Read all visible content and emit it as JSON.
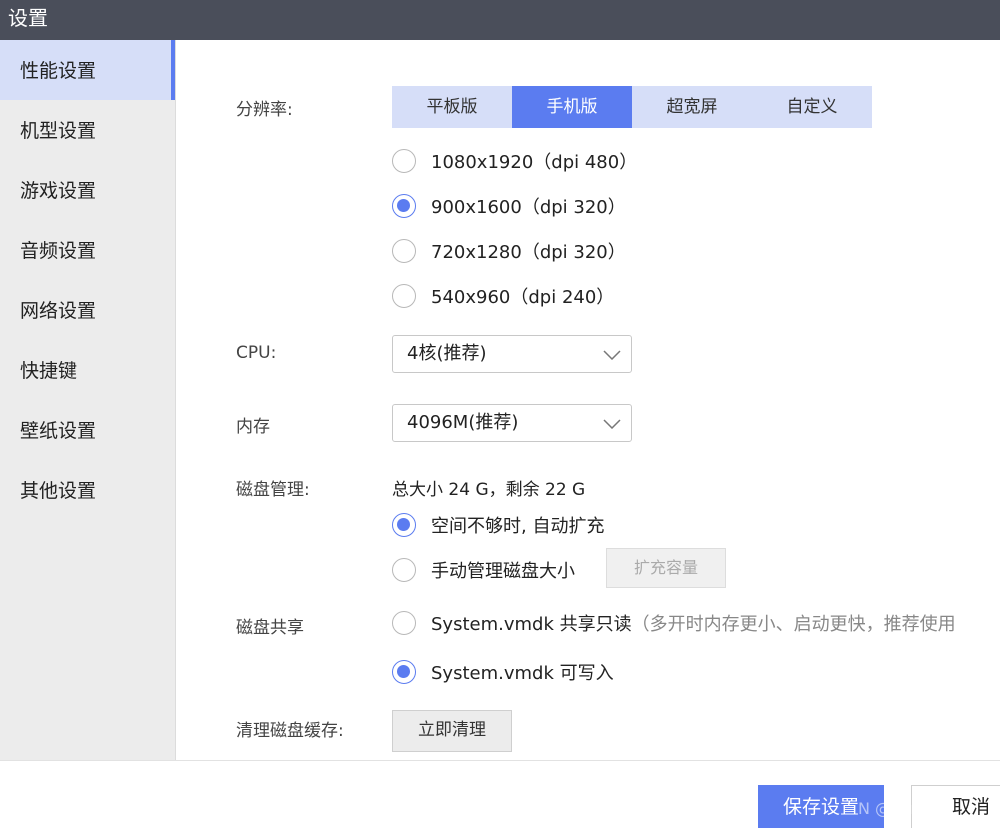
{
  "window": {
    "title": "设置"
  },
  "sidebar": {
    "items": [
      {
        "label": "性能设置"
      },
      {
        "label": "机型设置"
      },
      {
        "label": "游戏设置"
      },
      {
        "label": "音频设置"
      },
      {
        "label": "网络设置"
      },
      {
        "label": "快捷键"
      },
      {
        "label": "壁纸设置"
      },
      {
        "label": "其他设置"
      }
    ],
    "active_index": 0
  },
  "resolution": {
    "label": "分辨率:",
    "tabs": [
      "平板版",
      "手机版",
      "超宽屏",
      "自定义"
    ],
    "active_tab": 1,
    "options": [
      "1080x1920（dpi 480）",
      "900x1600（dpi 320）",
      "720x1280（dpi 320）",
      "540x960（dpi 240）"
    ],
    "selected_option": 1
  },
  "cpu": {
    "label": "CPU:",
    "value": "4核(推荐)"
  },
  "memory": {
    "label": "内存",
    "value": "4096M(推荐)"
  },
  "disk": {
    "label": "磁盘管理:",
    "summary": "总大小 24 G，剩余 22 G",
    "options": [
      "空间不够时, 自动扩充",
      "手动管理磁盘大小"
    ],
    "selected_option": 0,
    "expand_button": "扩充容量"
  },
  "disk_share": {
    "label": "磁盘共享",
    "options": [
      {
        "text": "System.vmdk 共享只读",
        "hint": "（多开时内存更小、启动更快，推荐使用"
      },
      {
        "text": "System.vmdk 可写入",
        "hint": ""
      }
    ],
    "selected_option": 1
  },
  "cache": {
    "label": "清理磁盘缓存:",
    "button": "立即清理"
  },
  "footer": {
    "save_button": "保存设置",
    "cancel_button": "取消",
    "watermark": "N @yangxi"
  },
  "colors": {
    "accent": "#5b7cf0",
    "accent_light": "#d6def8",
    "titlebar": "#4a4e5a",
    "sidebar": "#ececec"
  }
}
